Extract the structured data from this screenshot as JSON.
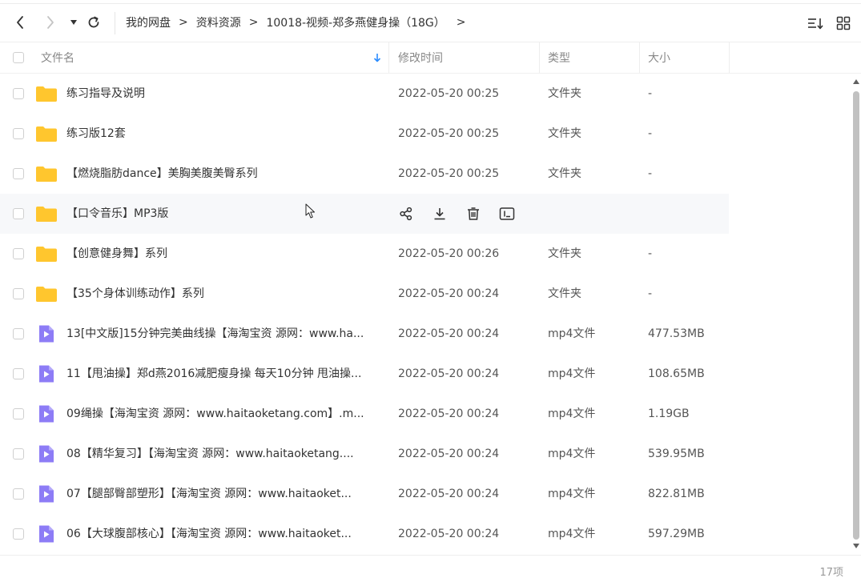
{
  "nav": {
    "back_icon": "chevron-left-icon",
    "forward_icon": "chevron-right-icon",
    "dropdown_icon": "caret-down-icon",
    "refresh_icon": "refresh-icon",
    "breadcrumb": [
      "我的网盘",
      "资料资源",
      "10018-视频-郑多燕健身操（18G）"
    ],
    "separator": ">",
    "trailing_separator": ">",
    "sort_icon": "sort-list-icon",
    "grid_icon": "grid-view-icon"
  },
  "header": {
    "name": "文件名",
    "modified": "修改时间",
    "type": "类型",
    "size": "大小",
    "sort_indicator_icon": "sort-down-arrow-icon",
    "sort_color": "#2b8cff"
  },
  "files": [
    {
      "name": "练习指导及说明",
      "kind": "folder",
      "modified": "2022-05-20 00:25",
      "type": "文件夹",
      "size": "-"
    },
    {
      "name": "练习版12套",
      "kind": "folder",
      "modified": "2022-05-20 00:25",
      "type": "文件夹",
      "size": "-"
    },
    {
      "name": "【燃烧脂肪dance】美胸美腹美臀系列",
      "kind": "folder",
      "modified": "2022-05-20 00:25",
      "type": "文件夹",
      "size": "-"
    },
    {
      "name": "【口令音乐】MP3版",
      "kind": "folder",
      "modified": "",
      "type": "",
      "size": "",
      "hovered": true
    },
    {
      "name": "【创意健身舞】系列",
      "kind": "folder",
      "modified": "2022-05-20 00:26",
      "type": "文件夹",
      "size": "-"
    },
    {
      "name": "【35个身体训练动作】系列",
      "kind": "folder",
      "modified": "2022-05-20 00:24",
      "type": "文件夹",
      "size": "-"
    },
    {
      "name": "13[中文版]15分钟完美曲线操【海淘宝资 源网：www.ha...",
      "kind": "video",
      "modified": "2022-05-20 00:24",
      "type": "mp4文件",
      "size": "477.53MB"
    },
    {
      "name": "11【甩油操】郑d燕2016减肥瘦身操 每天10分钟 甩油操...",
      "kind": "video",
      "modified": "2022-05-20 00:24",
      "type": "mp4文件",
      "size": "108.65MB"
    },
    {
      "name": "09绳操【海淘宝资 源网：www.haitaoketang.com】.m...",
      "kind": "video",
      "modified": "2022-05-20 00:24",
      "type": "mp4文件",
      "size": "1.19GB"
    },
    {
      "name": "08【精华复习】【海淘宝资 源网：www.haitaoketang....",
      "kind": "video",
      "modified": "2022-05-20 00:24",
      "type": "mp4文件",
      "size": "539.95MB"
    },
    {
      "name": "07【腿部臀部塑形】【海淘宝资 源网：www.haitaoket...",
      "kind": "video",
      "modified": "2022-05-20 00:24",
      "type": "mp4文件",
      "size": "822.81MB"
    },
    {
      "name": "06【大球腹部核心】【海淘宝资 源网：www.haitaoket...",
      "kind": "video",
      "modified": "2022-05-20 00:24",
      "type": "mp4文件",
      "size": "597.29MB"
    }
  ],
  "row_actions": [
    "share-icon",
    "download-icon",
    "delete-icon",
    "rename-icon"
  ],
  "footer": {
    "count": "17项"
  },
  "colors": {
    "folder": "#ffc62e",
    "video": "#8d7cf6",
    "hover_row": "#f7f8fa"
  }
}
